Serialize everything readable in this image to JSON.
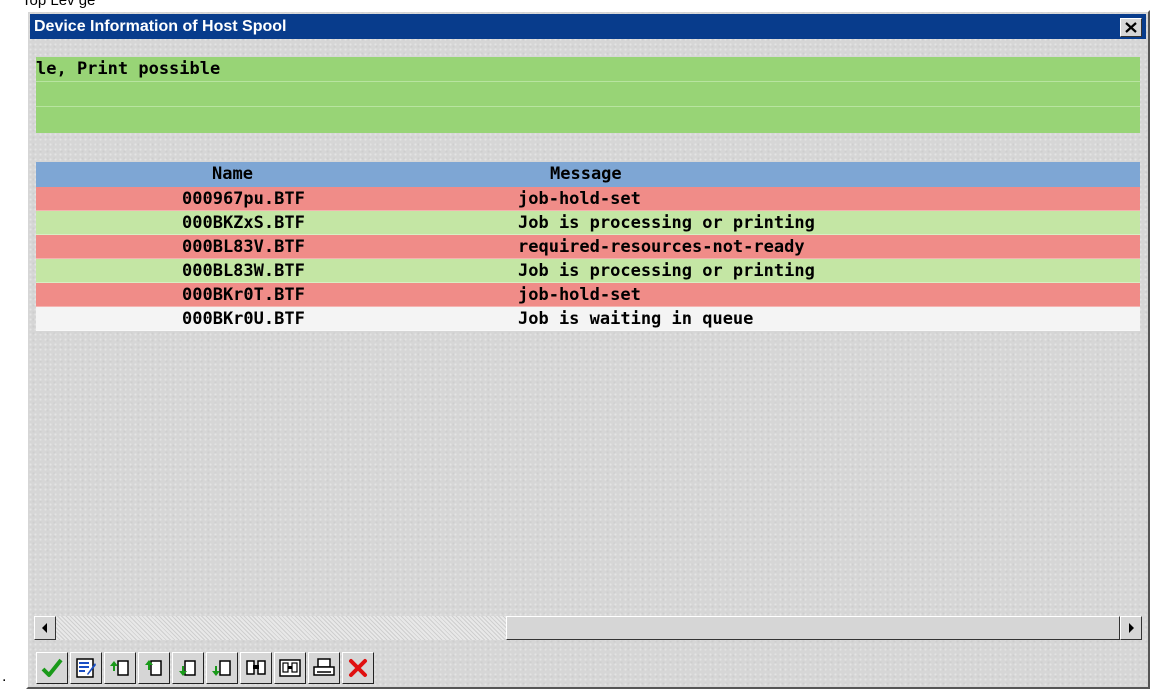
{
  "background_text": "Top Lev   ge",
  "bullet": ".",
  "window": {
    "title": "Device Information of Host Spool",
    "close_label": "×"
  },
  "status_lines": [
    "le, Print possible",
    "",
    ""
  ],
  "table": {
    "columns": [
      "Name",
      "Message"
    ],
    "rows": [
      {
        "name": "000967pu.BTF",
        "message": "job-hold-set",
        "status": "error"
      },
      {
        "name": "000BKZxS.BTF",
        "message": "Job is processing or printing",
        "status": "ok"
      },
      {
        "name": "000BL83V.BTF",
        "message": "required-resources-not-ready",
        "status": "error"
      },
      {
        "name": "000BL83W.BTF",
        "message": "Job is processing or printing",
        "status": "ok"
      },
      {
        "name": "000BKr0T.BTF",
        "message": "job-hold-set",
        "status": "error"
      },
      {
        "name": "000BKr0U.BTF",
        "message": "Job is waiting in queue",
        "status": "neutral"
      }
    ]
  },
  "colors": {
    "title_bar": "#083c8c",
    "status_green": "#98d476",
    "row_error": "#f08c88",
    "row_ok": "#c4e6a4",
    "row_neutral": "#f4f4f4",
    "header_blue": "#7ea6d4"
  },
  "toolbar": [
    {
      "icon": "checkmark-icon",
      "tooltip": ""
    },
    {
      "icon": "edit-icon",
      "tooltip": ""
    },
    {
      "icon": "first-page-icon",
      "tooltip": ""
    },
    {
      "icon": "previous-page-icon",
      "tooltip": ""
    },
    {
      "icon": "next-page-icon",
      "tooltip": ""
    },
    {
      "icon": "last-page-icon",
      "tooltip": ""
    },
    {
      "icon": "find-icon",
      "tooltip": ""
    },
    {
      "icon": "find-next-icon",
      "tooltip": ""
    },
    {
      "icon": "print-icon",
      "tooltip": ""
    },
    {
      "icon": "cancel-icon",
      "tooltip": ""
    }
  ]
}
